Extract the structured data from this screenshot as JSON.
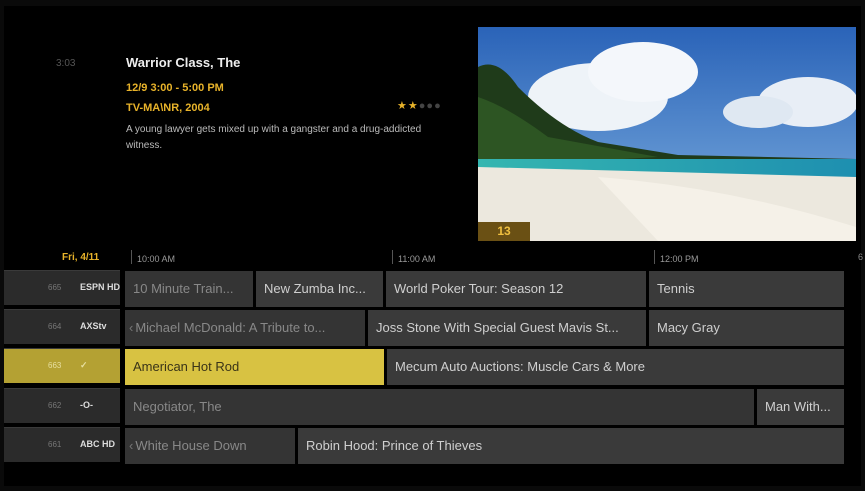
{
  "info": {
    "time_left": "3:03",
    "title": "Warrior Class, The",
    "date_time": "12/9 3:00 - 5:00 PM",
    "rating_year": "TV-MA\\NR, 2004",
    "description": "A young lawyer gets mixed up with a gangster and a drug-addicted witness.",
    "stars": {
      "filled": 2,
      "total": 5
    },
    "channel_badge": "13"
  },
  "guide": {
    "date": "Fri, 4/11",
    "times": [
      "10:00 AM",
      "11:00 AM",
      "12:00 PM"
    ],
    "edge_mark": "6",
    "channels": [
      {
        "number": "665",
        "logo": "ESPN HD",
        "icon": "channel-logo-icon"
      },
      {
        "number": "664",
        "logo": "AXStv",
        "icon": "channel-logo-icon"
      },
      {
        "number": "663",
        "logo": "✓",
        "icon": "velocity-logo-icon"
      },
      {
        "number": "662",
        "logo": "-O-",
        "icon": "channel-logo-icon"
      },
      {
        "number": "661",
        "logo": "ABC HD",
        "icon": "channel-logo-icon"
      }
    ],
    "programs": [
      [
        "10 Minute Train...",
        "New Zumba Inc...",
        "World Poker Tour: Season 12",
        "Tennis"
      ],
      [
        "Michael McDonald: A Tribute to...",
        "Joss Stone With Special Guest Mavis St...",
        "Macy Gray"
      ],
      [
        "American Hot Rod",
        "Mecum Auto Auctions: Muscle Cars & More"
      ],
      [
        "Negotiator, The",
        "Man With..."
      ],
      [
        "White House Down",
        "Robin Hood: Prince of Thieves"
      ]
    ]
  },
  "colors": {
    "accent": "#e8b32a",
    "selected": "#d8c242",
    "cell": "#343434"
  }
}
